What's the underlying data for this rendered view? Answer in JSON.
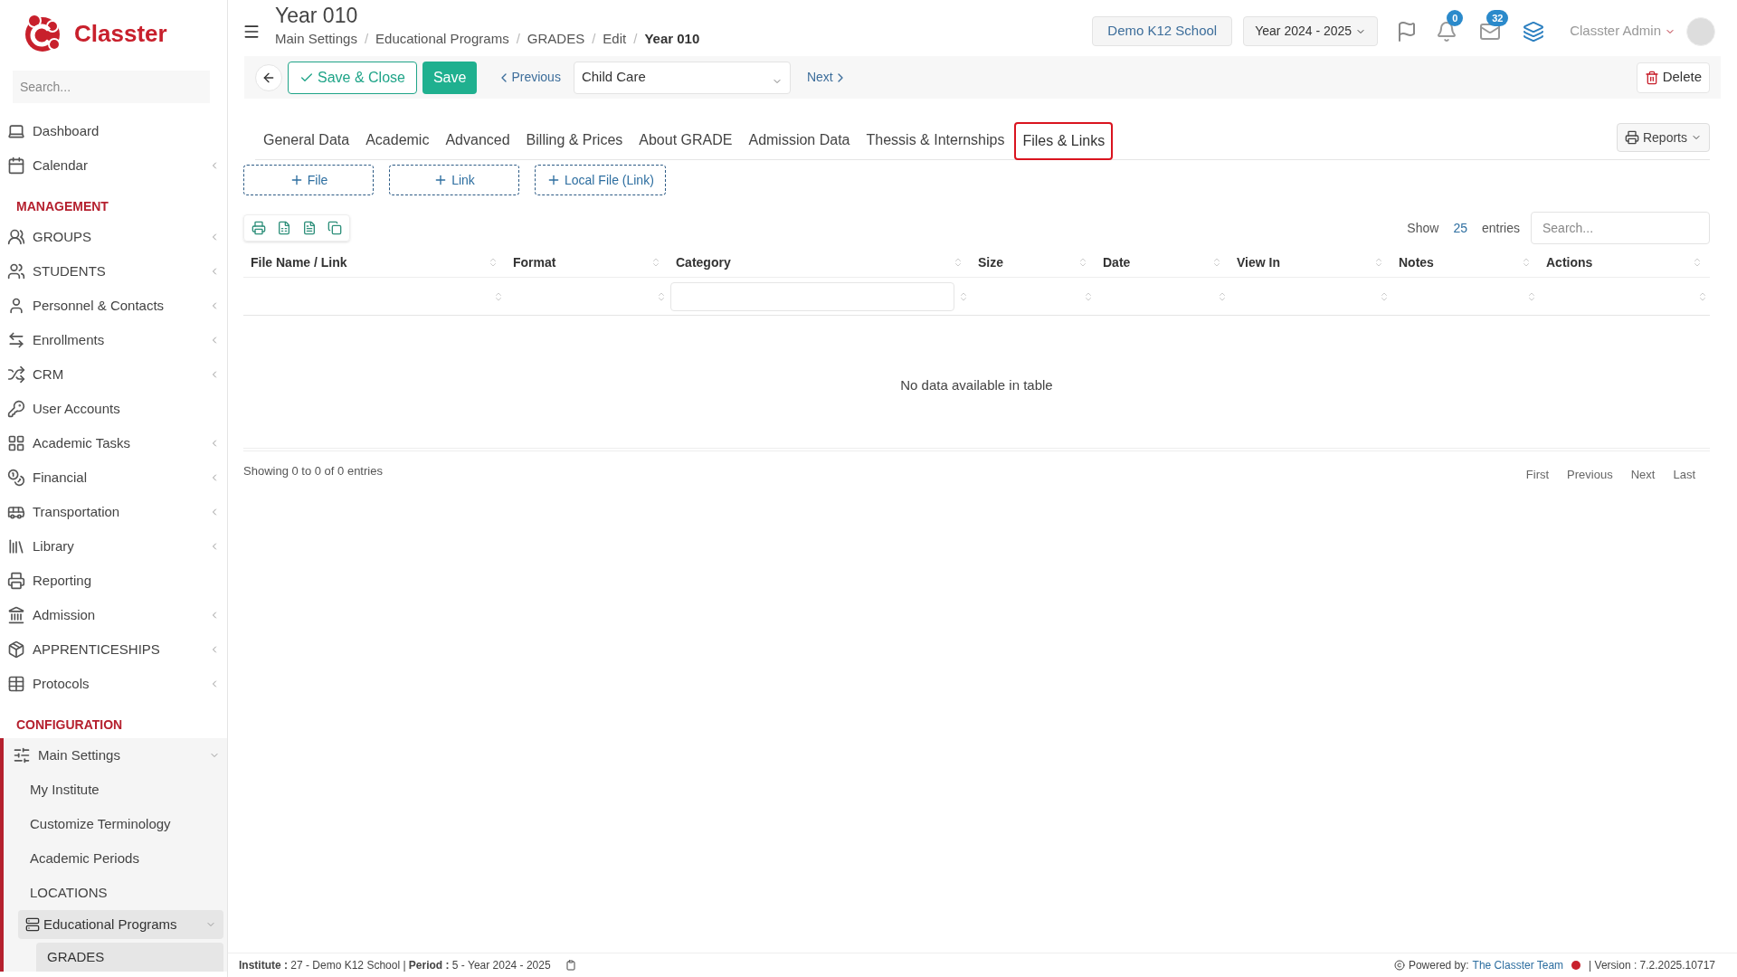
{
  "brand": {
    "name": "Classter"
  },
  "sidebar": {
    "search_placeholder": "Search...",
    "items": [
      {
        "kind": "item",
        "label": "Dashboard",
        "has_submenu": false
      },
      {
        "kind": "item",
        "label": "Calendar",
        "has_submenu": true
      },
      {
        "kind": "section",
        "label": "MANAGEMENT"
      },
      {
        "kind": "item",
        "label": "GROUPS",
        "has_submenu": true
      },
      {
        "kind": "item",
        "label": "STUDENTS",
        "has_submenu": true
      },
      {
        "kind": "item",
        "label": "Personnel & Contacts",
        "has_submenu": true
      },
      {
        "kind": "item",
        "label": "Enrollments",
        "has_submenu": true
      },
      {
        "kind": "item",
        "label": "CRM",
        "has_submenu": true
      },
      {
        "kind": "item",
        "label": "User Accounts",
        "has_submenu": false
      },
      {
        "kind": "item",
        "label": "Academic Tasks",
        "has_submenu": true
      },
      {
        "kind": "item",
        "label": "Financial",
        "has_submenu": true
      },
      {
        "kind": "item",
        "label": "Transportation",
        "has_submenu": true
      },
      {
        "kind": "item",
        "label": "Library",
        "has_submenu": true
      },
      {
        "kind": "item",
        "label": "Reporting",
        "has_submenu": false
      },
      {
        "kind": "item",
        "label": "Admission",
        "has_submenu": true
      },
      {
        "kind": "item",
        "label": "APPRENTICESHIPS",
        "has_submenu": true
      },
      {
        "kind": "item",
        "label": "Protocols",
        "has_submenu": true
      },
      {
        "kind": "section",
        "label": "CONFIGURATION"
      },
      {
        "kind": "item",
        "label": "Main Settings",
        "has_submenu": true,
        "expanded": true,
        "children": [
          {
            "label": "My Institute",
            "selected": false
          },
          {
            "label": "Customize Terminology",
            "selected": false
          },
          {
            "label": "Academic Periods",
            "selected": false
          },
          {
            "label": "LOCATIONS",
            "selected": false
          },
          {
            "label": "Educational Programs",
            "selected": true,
            "expanded": true,
            "children": [
              {
                "label": "GRADES",
                "selected": true
              }
            ]
          }
        ]
      }
    ]
  },
  "header": {
    "title": "Year 010",
    "breadcrumb_separator": "/",
    "breadcrumb": [
      "Main Settings",
      "Educational Programs",
      "GRADES",
      "Edit",
      "Year 010"
    ],
    "school": "Demo K12 School",
    "year": "Year 2024 - 2025",
    "notifications": "0",
    "messages": "32",
    "user": "Classter Admin"
  },
  "toolbar": {
    "save_close": "Save & Close",
    "save": "Save",
    "previous": "Previous",
    "record": "Child Care",
    "next": "Next",
    "delete": "Delete"
  },
  "tabs": [
    {
      "label": "General Data",
      "selected": false
    },
    {
      "label": "Academic",
      "selected": false
    },
    {
      "label": "Advanced",
      "selected": false
    },
    {
      "label": "Billing & Prices",
      "selected": false
    },
    {
      "label": "About GRADE",
      "selected": false
    },
    {
      "label": "Admission Data",
      "selected": false
    },
    {
      "label": "Thessis & Internships",
      "selected": false
    },
    {
      "label": "Files & Links",
      "selected": true
    }
  ],
  "reports": "Reports",
  "add_buttons": [
    "File",
    "Link",
    "Local File (Link)"
  ],
  "table": {
    "show": "Show",
    "entries_count": "25",
    "entries": "entries",
    "search_placeholder": "Search...",
    "columns": [
      "File Name / Link",
      "Format",
      "Category",
      "Size",
      "Date",
      "View In",
      "Notes",
      "Actions"
    ],
    "empty": "No data available in table",
    "info": "Showing 0 to 0 of 0 entries",
    "pager": [
      "First",
      "Previous",
      "Next",
      "Last"
    ]
  },
  "status_bar": {
    "info": "**Institute :** 27 - Demo K12 School | **Period :** 5 - Year 2024 - 2025",
    "powered": "Powered by:",
    "team": "The Classter Team",
    "version": "| Version : 7.2.2025.10717"
  }
}
